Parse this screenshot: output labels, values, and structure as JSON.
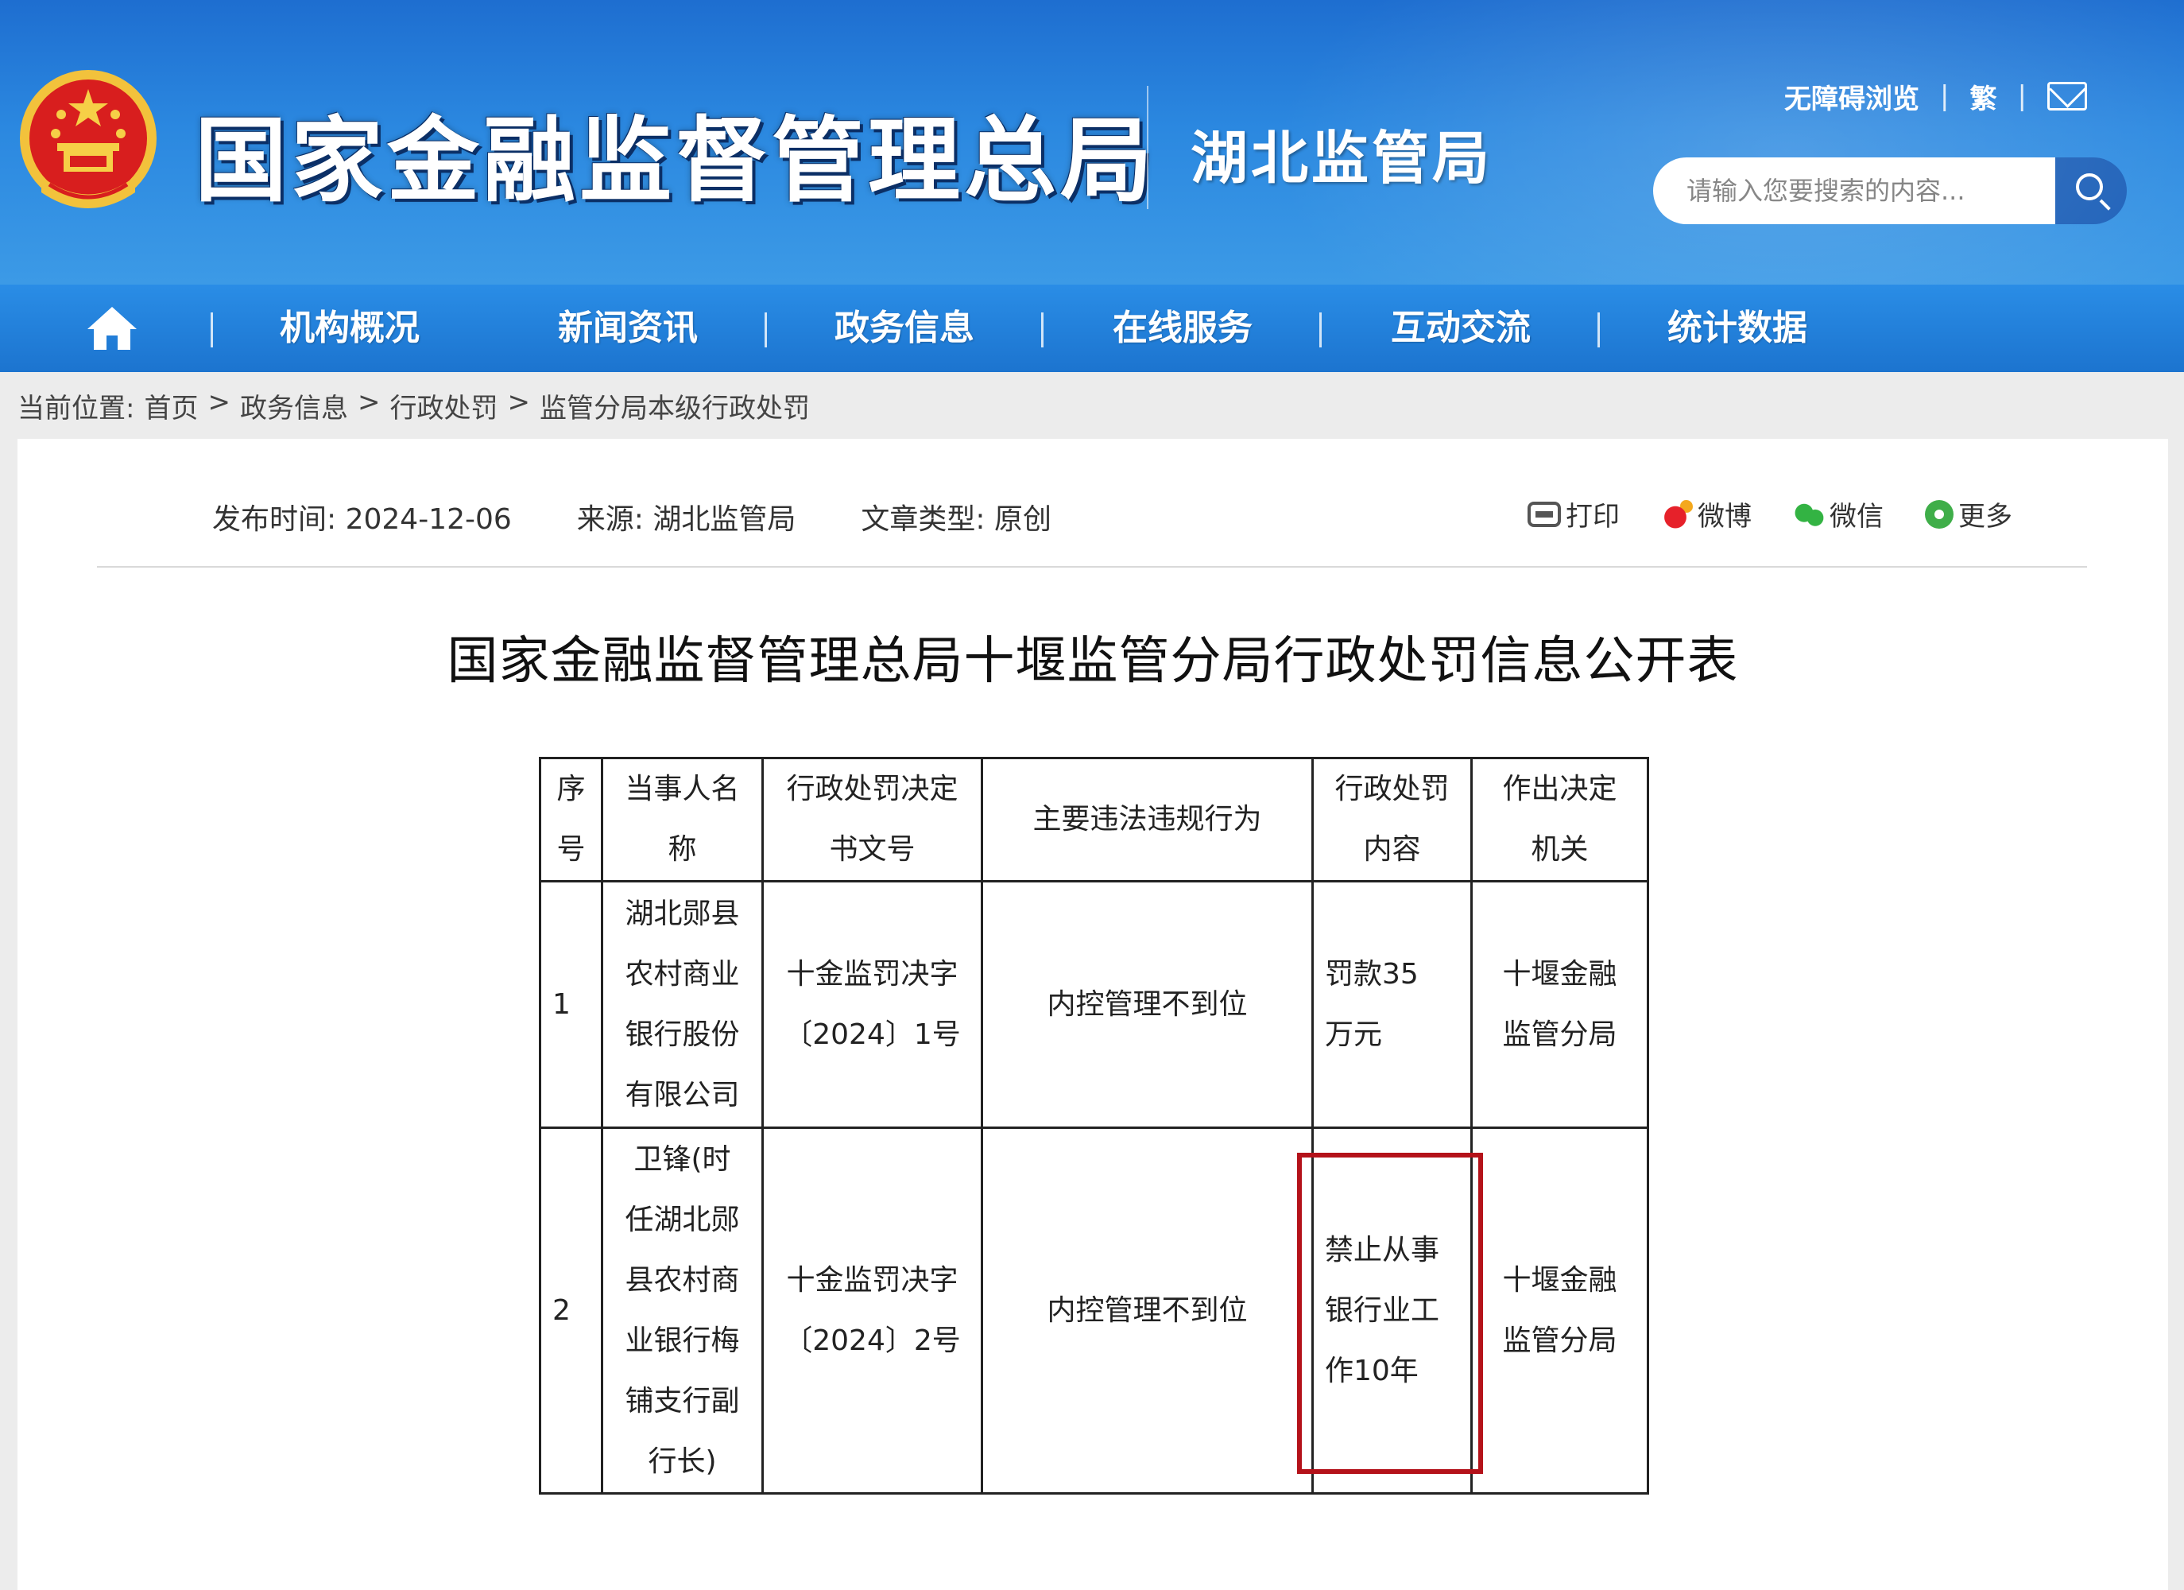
{
  "header": {
    "site_title": "国家金融监督管理总局",
    "sub_title": "湖北监管局",
    "top_links": {
      "accessible": "无障碍浏览",
      "lang": "繁"
    },
    "search_placeholder": "请输入您要搜索的内容...",
    "icons": {
      "emblem": "national-emblem-icon",
      "mail": "mail-icon",
      "search": "search-icon"
    }
  },
  "nav": {
    "items": [
      "机构概况",
      "新闻资讯",
      "政务信息",
      "在线服务",
      "互动交流",
      "统计数据"
    ]
  },
  "breadcrumb": {
    "prefix": "当前位置:",
    "items": [
      "首页",
      "政务信息",
      "行政处罚",
      "监管分局本级行政处罚"
    ],
    "separator": ">"
  },
  "article": {
    "publish": "发布时间: 2024-12-06",
    "source": "来源: 湖北监管局",
    "type": "文章类型: 原创",
    "share": {
      "print": "打印",
      "weibo": "微博",
      "wechat": "微信",
      "more": "更多"
    },
    "title": "国家金融监督管理总局十堰监管分局行政处罚信息公开表"
  },
  "table": {
    "headers": [
      [
        "序",
        "号"
      ],
      [
        "当事人名",
        "称"
      ],
      [
        "行政处罚决定",
        "书文号"
      ],
      [
        "主要违法违规行为"
      ],
      [
        "行政处罚",
        "内容"
      ],
      [
        "作出决定",
        "机关"
      ]
    ],
    "rows": [
      {
        "no": "1",
        "party": [
          "湖北郧县",
          "农村商业",
          "银行股份",
          "有限公司"
        ],
        "doc": [
          "十金监罚决字",
          "〔2024〕1号"
        ],
        "violation": "内控管理不到位",
        "penalty": [
          "罚款35",
          "万元"
        ],
        "authority": [
          "十堰金融",
          "监管分局"
        ]
      },
      {
        "no": "2",
        "party": [
          "卫锋(时",
          "任湖北郧",
          "县农村商",
          "业银行梅",
          "铺支行副",
          "行长)"
        ],
        "doc": [
          "十金监罚决字",
          "〔2024〕2号"
        ],
        "violation": "内控管理不到位",
        "penalty": [
          "禁止从事",
          "银行业工",
          "作10年"
        ],
        "authority": [
          "十堰金融",
          "监管分局"
        ]
      }
    ]
  },
  "colors": {
    "header_blue": "#1e6ed0",
    "nav_blue": "#1c74cf",
    "highlight_red": "#b4121a"
  }
}
